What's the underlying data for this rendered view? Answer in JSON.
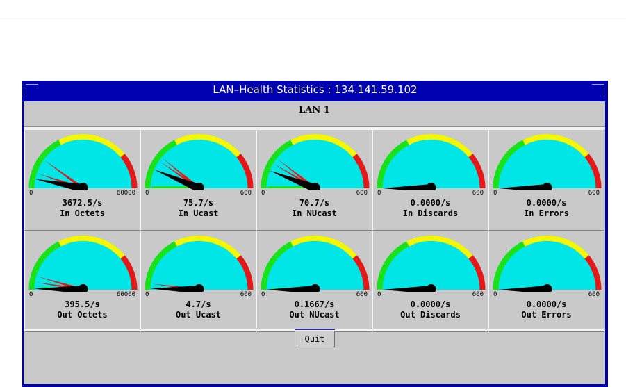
{
  "window": {
    "title": "LAN–Health Statistics : 134.141.59.102"
  },
  "lan_label": "LAN 1",
  "quit_label": "Quit",
  "colors": {
    "face": "#00e5e5",
    "green": "#19e219",
    "yellow": "#f6f600",
    "red": "#e61717",
    "needle": "#000000",
    "frame": "#0000b0",
    "client": "#c9c9c9"
  },
  "gauges": [
    {
      "value_text": "3672.5/s",
      "label": "In Octets",
      "min": "0",
      "max": "60000",
      "level": 0.061,
      "extra_needles": [
        0.2,
        0.1
      ]
    },
    {
      "value_text": "75.7/s",
      "label": "In Ucast",
      "min": "0",
      "max": "600",
      "level": 0.126,
      "extra_needles": [
        0.22,
        0.19,
        0.0
      ]
    },
    {
      "value_text": "70.7/s",
      "label": "In NUcast",
      "min": "0",
      "max": "600",
      "level": 0.118,
      "extra_needles": [
        0.21,
        0.17,
        0.0
      ]
    },
    {
      "value_text": "0.0000/s",
      "label": "In Discards",
      "min": "0",
      "max": "600",
      "level": 0.0,
      "extra_needles": []
    },
    {
      "value_text": "0.0000/s",
      "label": "In Errors",
      "min": "0",
      "max": "600",
      "level": 0.0,
      "extra_needles": []
    },
    {
      "value_text": "395.5/s",
      "label": "Out Octets",
      "min": "0",
      "max": "60000",
      "level": 0.007,
      "extra_needles": [
        0.09,
        0.05,
        0.02
      ]
    },
    {
      "value_text": "4.7/s",
      "label": "Out Ucast",
      "min": "0",
      "max": "600",
      "level": 0.008,
      "extra_needles": [
        0.04,
        0.015,
        0.005
      ]
    },
    {
      "value_text": "0.1667/s",
      "label": "Out NUcast",
      "min": "0",
      "max": "600",
      "level": 0.0003,
      "extra_needles": [
        0.01
      ]
    },
    {
      "value_text": "0.0000/s",
      "label": "Out Discards",
      "min": "0",
      "max": "600",
      "level": 0.0,
      "extra_needles": []
    },
    {
      "value_text": "0.0000/s",
      "label": "Out Errors",
      "min": "0",
      "max": "600",
      "level": 0.0,
      "extra_needles": []
    }
  ]
}
